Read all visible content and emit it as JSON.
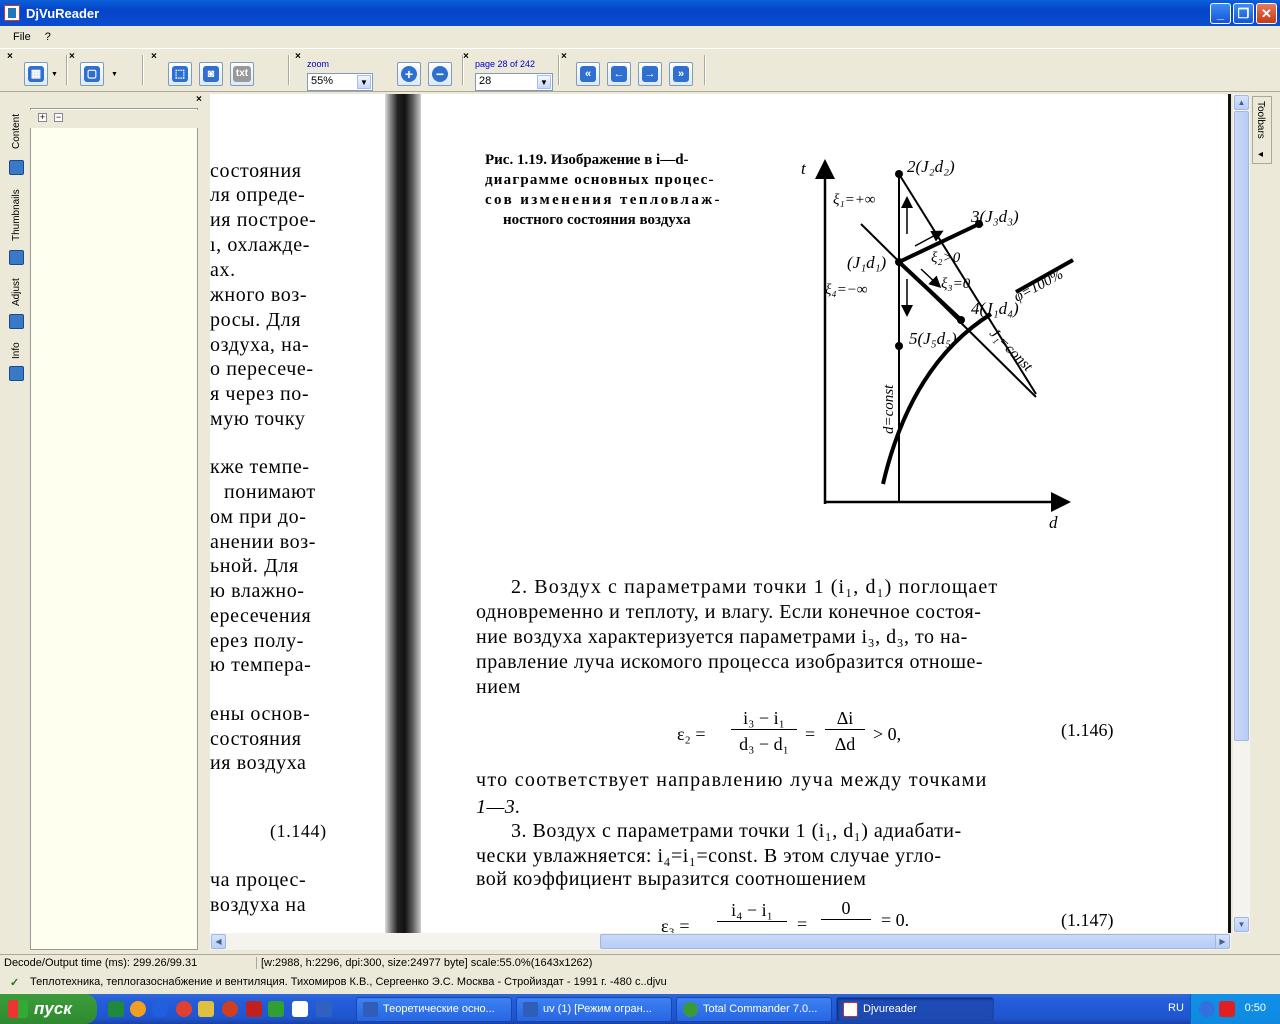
{
  "window": {
    "title": "DjVuReader",
    "min_label": "_",
    "max_label": "❐",
    "close_label": "✕"
  },
  "menu": {
    "file": "File",
    "help": "?"
  },
  "toolbar": {
    "zoom_label": "zoom",
    "zoom_value": "55%",
    "page_label": "page 28 of 242",
    "page_value": "28",
    "text_button": "txt",
    "close_glyph": "×",
    "icons": [
      "layout-icon",
      "page-icon",
      "select-rect-icon",
      "screenshot-icon",
      "text-icon",
      "zoom-in-icon",
      "zoom-out-icon",
      "first-page-icon",
      "prev-page-icon",
      "next-page-icon",
      "last-page-icon"
    ]
  },
  "sidebar": {
    "tabs": [
      "Content",
      "Thumbnails",
      "Adjust",
      "Info"
    ],
    "expand_label": "+",
    "collapse_label": "−",
    "close_glyph": "×"
  },
  "right_tab": {
    "label": "Toolbars",
    "arrow": "◂"
  },
  "document": {
    "left_lines": [
      "состояния",
      "ля опреде-",
      "ия построе-",
      "ı, охлажде-",
      "ах.",
      "жного воз-",
      "росы. Для",
      "оздуха, на-",
      "о пересече-",
      "я через по-",
      "мую точку",
      "",
      "кже темпе-",
      "понимают",
      "ом при до-",
      "анении воз-",
      "ьной. Для",
      "ю влажно-",
      "ересечения",
      "ерез полу-",
      "ю темпера-",
      "",
      "ены основ-",
      "состояния",
      "ия воздуха",
      "",
      "(1.144)",
      "",
      "ча процес-",
      "воздуха на"
    ],
    "caption": [
      "Рис. 1.19. Изображение в i—d-",
      "диаграмме основных процес-",
      "сов изменения тепловлаж-",
      "ностного состояния воздуха"
    ],
    "diagram": {
      "axis_y": "t",
      "axis_x": "d",
      "point1": "(J₁d₁)",
      "point2": "2(J₂d₂)",
      "point3": "3(J₃d₃)",
      "point4": "4(J₁d₄)",
      "point5": "5(J₅d₅)",
      "xi1": "ξ₁=+∞",
      "xi2": "ξ₂>0",
      "xi3": "ξ₃=0",
      "xi4": "ξ₄=−∞",
      "phi": "φ=100%",
      "dconst": "d=const",
      "jconst": "J₁=const"
    },
    "para2": [
      "2. Воздух с параметрами точки 1 (i₁, d₁) поглощает",
      "одновременно и теплоту, и влагу. Если конечное состоя-",
      "ние воздуха характеризуется параметрами i₃, d₃, то на-",
      "правление луча искомого процесса изобразится отноше-",
      "нием"
    ],
    "eq146": {
      "lhs": "ε₂ =",
      "num1": "i₃ − i₁",
      "den1": "d₃ − d₁",
      "eq": "=",
      "num2": "Δi",
      "den2": "Δd",
      "rhs": "> 0,",
      "number": "(1.146)"
    },
    "para2b": [
      "что соответствует направлению луча между точками",
      "1—3."
    ],
    "para3": [
      "3. Воздух с параметрами точки 1 (i₁, d₁) адиабати-",
      "чески увлажняется: i₄=i₁=const. В этом случае угло-",
      "вой коэффициент выразится соотношением"
    ],
    "eq147": {
      "lhs": "ε₃ =",
      "num1": "i₄ − i₁",
      "eq": "=",
      "num2": "0",
      "rhs": "= 0.",
      "number": "(1.147)"
    }
  },
  "status": {
    "decode": "Decode/Output time (ms): 299.26/99.31",
    "info": "[w:2988, h:2296, dpi:300, size:24977 byte] scale:55.0%(1643x1262)",
    "file": "Теплотехника, теплогазоснабжение и вентиляция. Тихомиров К.В., Сергеенко Э.С. Москва - Стройиздат - 1991 г. -480 с..djvu"
  },
  "taskbar": {
    "start": "пуск",
    "tasks": [
      "Теоретические осно...",
      "uv (1) [Режим огран...",
      "Total Commander 7.0...",
      "Djvureader"
    ],
    "lang": "RU",
    "clock": "0:50"
  },
  "colors": {
    "title_blue": "#0543c8",
    "taskbar_blue": "#245edb",
    "start_green": "#2f8a2f",
    "chrome": "#ece9d8"
  }
}
